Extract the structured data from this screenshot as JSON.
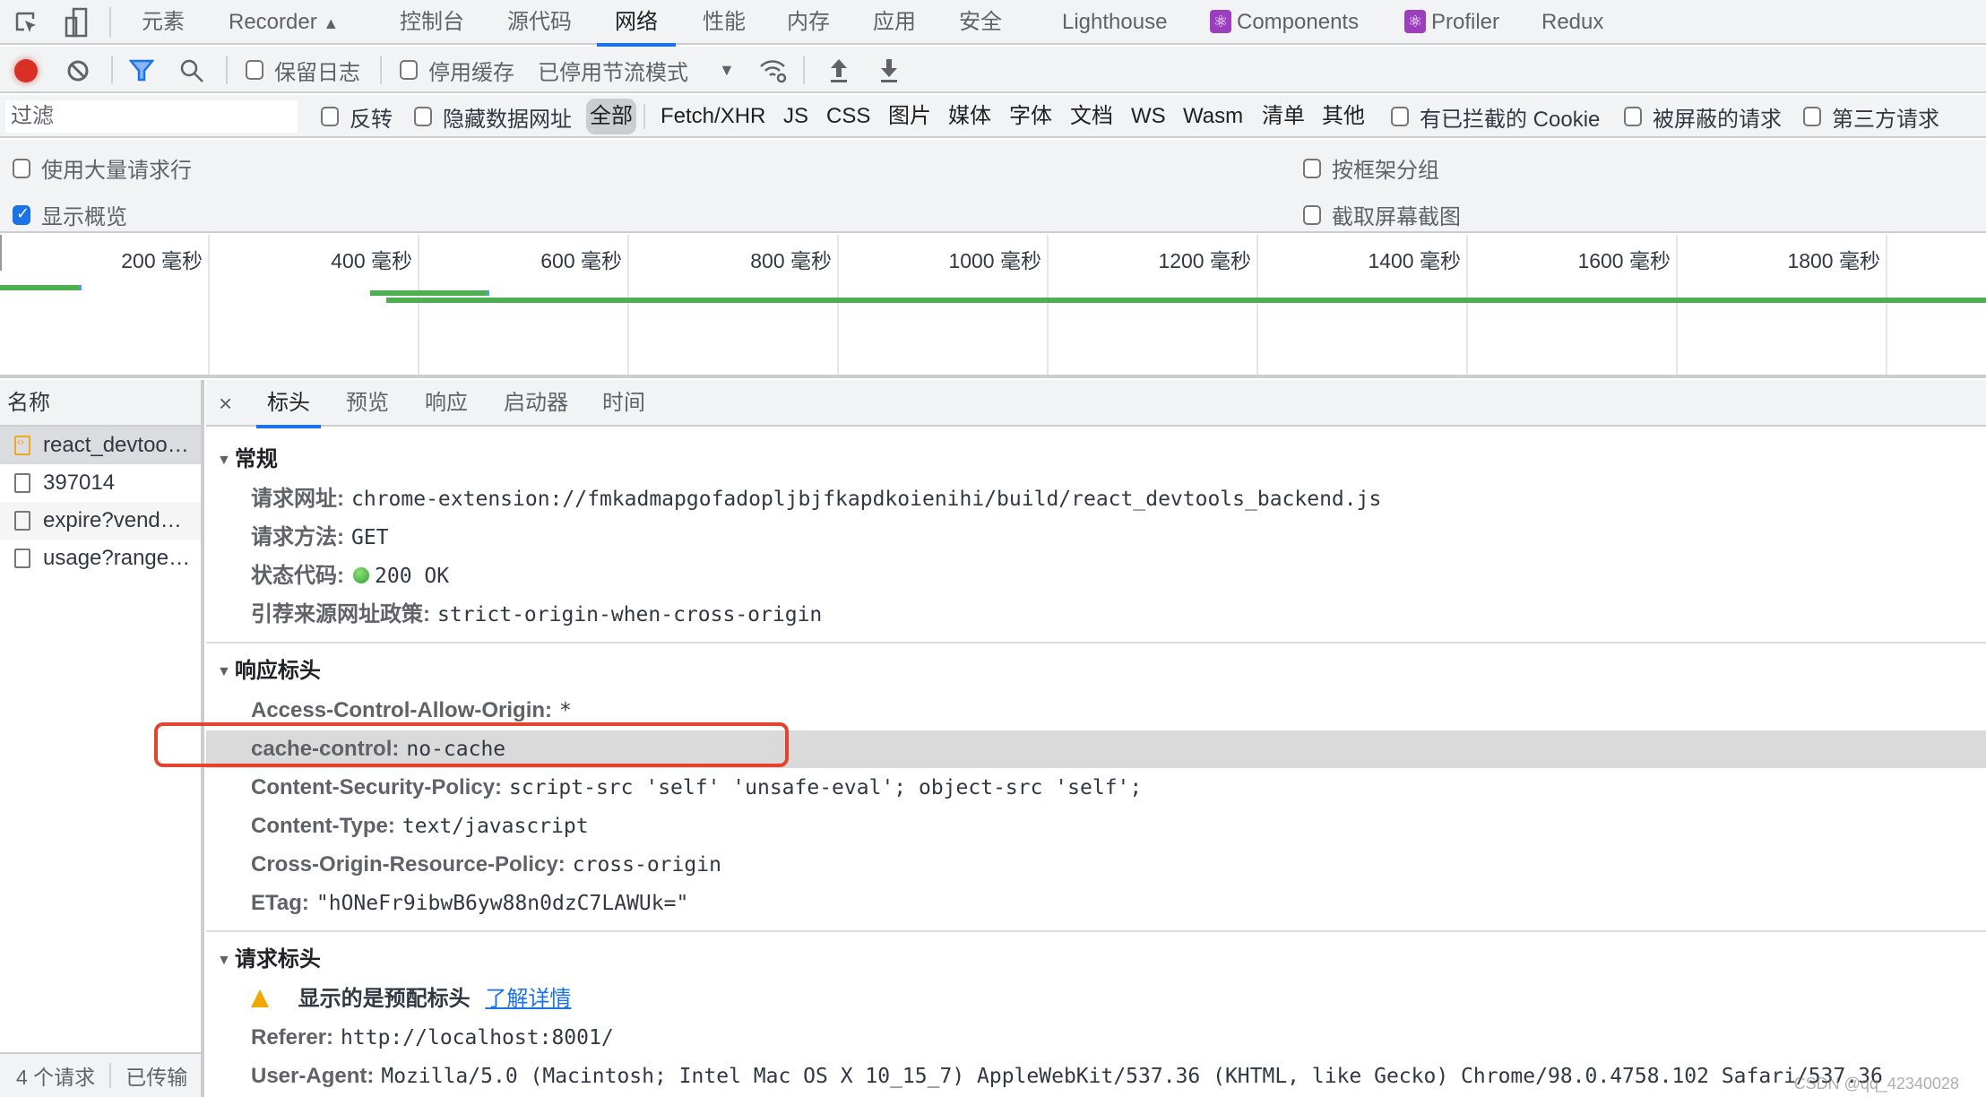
{
  "devtools_tabs": [
    {
      "label": "元素",
      "active": false
    },
    {
      "label": "Recorder",
      "active": false,
      "badge": "flask-icon"
    },
    {
      "label": "控制台",
      "active": false
    },
    {
      "label": "源代码",
      "active": false
    },
    {
      "label": "网络",
      "active": true
    },
    {
      "label": "性能",
      "active": false
    },
    {
      "label": "内存",
      "active": false
    },
    {
      "label": "应用",
      "active": false
    },
    {
      "label": "安全",
      "active": false
    },
    {
      "label": "Lighthouse",
      "active": false
    },
    {
      "label": "Components",
      "active": false,
      "badge": "react-icon"
    },
    {
      "label": "Profiler",
      "active": false,
      "badge": "react-icon"
    },
    {
      "label": "Redux",
      "active": false
    }
  ],
  "toolbar": {
    "record_icon": "record-icon",
    "clear_icon": "clear-icon",
    "filter_icon": "filter-icon",
    "search_icon": "search-icon",
    "preserve_log": {
      "label": "保留日志",
      "checked": false
    },
    "disable_cache": {
      "label": "停用缓存",
      "checked": false
    },
    "throttling": {
      "value": "已停用节流模式"
    },
    "network_conditions_icon": "network-conditions-icon",
    "import_icon": "upload-icon",
    "export_icon": "download-icon"
  },
  "filter_bar": {
    "placeholder": "过滤",
    "value": "",
    "invert": {
      "label": "反转",
      "checked": false
    },
    "hide_data_urls": {
      "label": "隐藏数据网址",
      "checked": false
    },
    "types": [
      {
        "label": "全部",
        "active": true
      },
      {
        "label": "Fetch/XHR",
        "active": false
      },
      {
        "label": "JS",
        "active": false
      },
      {
        "label": "CSS",
        "active": false
      },
      {
        "label": "图片",
        "active": false
      },
      {
        "label": "媒体",
        "active": false
      },
      {
        "label": "字体",
        "active": false
      },
      {
        "label": "文档",
        "active": false
      },
      {
        "label": "WS",
        "active": false
      },
      {
        "label": "Wasm",
        "active": false
      },
      {
        "label": "清单",
        "active": false
      },
      {
        "label": "其他",
        "active": false
      }
    ],
    "blocked_cookies": {
      "label": "有已拦截的 Cookie",
      "checked": false
    },
    "blocked_requests": {
      "label": "被屏蔽的请求",
      "checked": false
    },
    "third_party": {
      "label": "第三方请求",
      "checked": false
    }
  },
  "options": {
    "big_rows": {
      "label": "使用大量请求行",
      "checked": false
    },
    "show_overview": {
      "label": "显示概览",
      "checked": true
    },
    "group_by_frame": {
      "label": "按框架分组",
      "checked": false
    },
    "capture_screenshots": {
      "label": "截取屏幕截图",
      "checked": false
    }
  },
  "overview": {
    "ticks": [
      "200 毫秒",
      "400 毫秒",
      "600 毫秒",
      "800 毫秒",
      "1000 毫秒",
      "1200 毫秒",
      "1400 毫秒",
      "1600 毫秒",
      "1800 毫秒"
    ],
    "bars_ms": [
      {
        "start": 0,
        "end": 78
      },
      {
        "start": 353,
        "end": 467
      },
      {
        "start": 368,
        "end": 2000
      }
    ]
  },
  "request_list": {
    "header": "名称",
    "rows": [
      {
        "name": "react_devtoo…",
        "icon": "script-file-icon",
        "selected": true
      },
      {
        "name": "397014",
        "icon": "document-file-icon",
        "selected": false
      },
      {
        "name": "expire?vend…",
        "icon": "document-file-icon",
        "selected": false
      },
      {
        "name": "usage?range…",
        "icon": "document-file-icon",
        "selected": false
      }
    ],
    "status": {
      "requests": "4 个请求",
      "transferred": "已传输"
    }
  },
  "details": {
    "close_icon": "close-icon",
    "tabs": [
      {
        "label": "标头",
        "active": true
      },
      {
        "label": "预览",
        "active": false
      },
      {
        "label": "响应",
        "active": false
      },
      {
        "label": "启动器",
        "active": false
      },
      {
        "label": "时间",
        "active": false
      }
    ],
    "general": {
      "title": "常规",
      "rows": [
        {
          "key": "请求网址:",
          "value": "chrome-extension://fmkadmapgofadopljbjfkapdkoienihi/build/react_devtools_backend.js"
        },
        {
          "key": "请求方法:",
          "value": "GET"
        },
        {
          "key": "状态代码:",
          "value": "200 OK",
          "status_color": "#34a853"
        },
        {
          "key": "引荐来源网址政策:",
          "value": "strict-origin-when-cross-origin"
        }
      ]
    },
    "response_headers": {
      "title": "响应标头",
      "rows": [
        {
          "key": "Access-Control-Allow-Origin:",
          "value": "*"
        },
        {
          "key": "cache-control:",
          "value": "no-cache",
          "highlighted": true
        },
        {
          "key": "Content-Security-Policy:",
          "value": "script-src 'self' 'unsafe-eval'; object-src 'self';"
        },
        {
          "key": "Content-Type:",
          "value": "text/javascript"
        },
        {
          "key": "Cross-Origin-Resource-Policy:",
          "value": "cross-origin"
        },
        {
          "key": "ETag:",
          "value": "\"hONeFr9ibwB6yw88n0dzC7LAWUk=\""
        }
      ]
    },
    "request_headers": {
      "title": "请求标头",
      "warning": {
        "text": "显示的是预配标头",
        "link": "了解详情"
      },
      "rows": [
        {
          "key": "Referer:",
          "value": "http://localhost:8001/"
        },
        {
          "key": "User-Agent:",
          "value": "Mozilla/5.0 (Macintosh; Intel Mac OS X 10_15_7) AppleWebKit/537.36 (KHTML, like Gecko) Chrome/98.0.4758.102 Safari/537.36"
        }
      ]
    }
  },
  "colors": {
    "accent": "#1a73e8",
    "record": "#d93025",
    "bar": "#4caf50",
    "annotation": "#e5432d",
    "react_badge": "#9b3fbf"
  },
  "watermark": "CSDN @qq_42340028"
}
